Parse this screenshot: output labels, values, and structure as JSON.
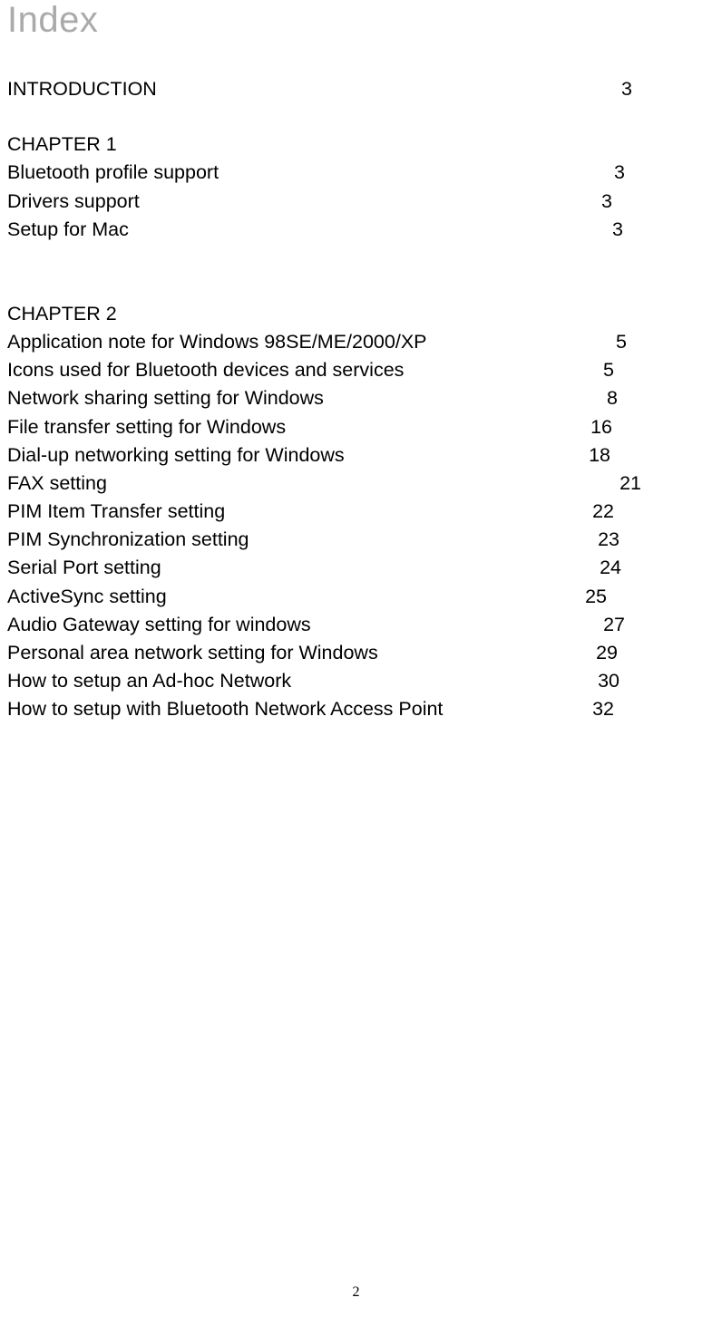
{
  "title": "Index",
  "intro": {
    "label": "INTRODUCTION",
    "page": "3"
  },
  "sections": [
    {
      "heading": "CHAPTER   1",
      "entries": [
        {
          "label": "Bluetooth profile support",
          "page": "3"
        },
        {
          "label": "Drivers support",
          "page": "3"
        },
        {
          "label": "Setup for Mac",
          "page": "3"
        }
      ]
    },
    {
      "heading": "CHAPTER   2",
      "entries": [
        {
          "label": "Application note for Windows 98SE/ME/2000/XP",
          "page": "5"
        },
        {
          "label": "Icons used for Bluetooth devices and services",
          "page": "5"
        },
        {
          "label": "Network sharing setting for Windows",
          "page": "8"
        },
        {
          "label": "File transfer setting for Windows",
          "page": "16"
        },
        {
          "label": "Dial-up networking setting for Windows",
          "page": "18"
        },
        {
          "label": "FAX setting",
          "page": "21"
        },
        {
          "label": "PIM Item Transfer setting",
          "page": "22"
        },
        {
          "label": "PIM Synchronization setting",
          "page": "23"
        },
        {
          "label": "Serial Port setting",
          "page": "24"
        },
        {
          "label": "ActiveSync setting",
          "page": "25"
        },
        {
          "label": "Audio Gateway setting for windows",
          "page": "27"
        },
        {
          "label": "Personal area network setting for Windows",
          "page": "29"
        },
        {
          "label": "How to setup an Ad-hoc Network",
          "page": "30"
        },
        {
          "label": "How to setup with Bluetooth Network Access Point",
          "page": "32"
        }
      ]
    }
  ],
  "page_number": "2",
  "page_offsets": {
    "intro": "80",
    "s0": [
      "88",
      "102",
      "90"
    ],
    "s1": [
      "86",
      "100",
      "96",
      "102",
      "104",
      "70",
      "100",
      "94",
      "92",
      "108",
      "88",
      "96",
      "94",
      "100"
    ]
  }
}
